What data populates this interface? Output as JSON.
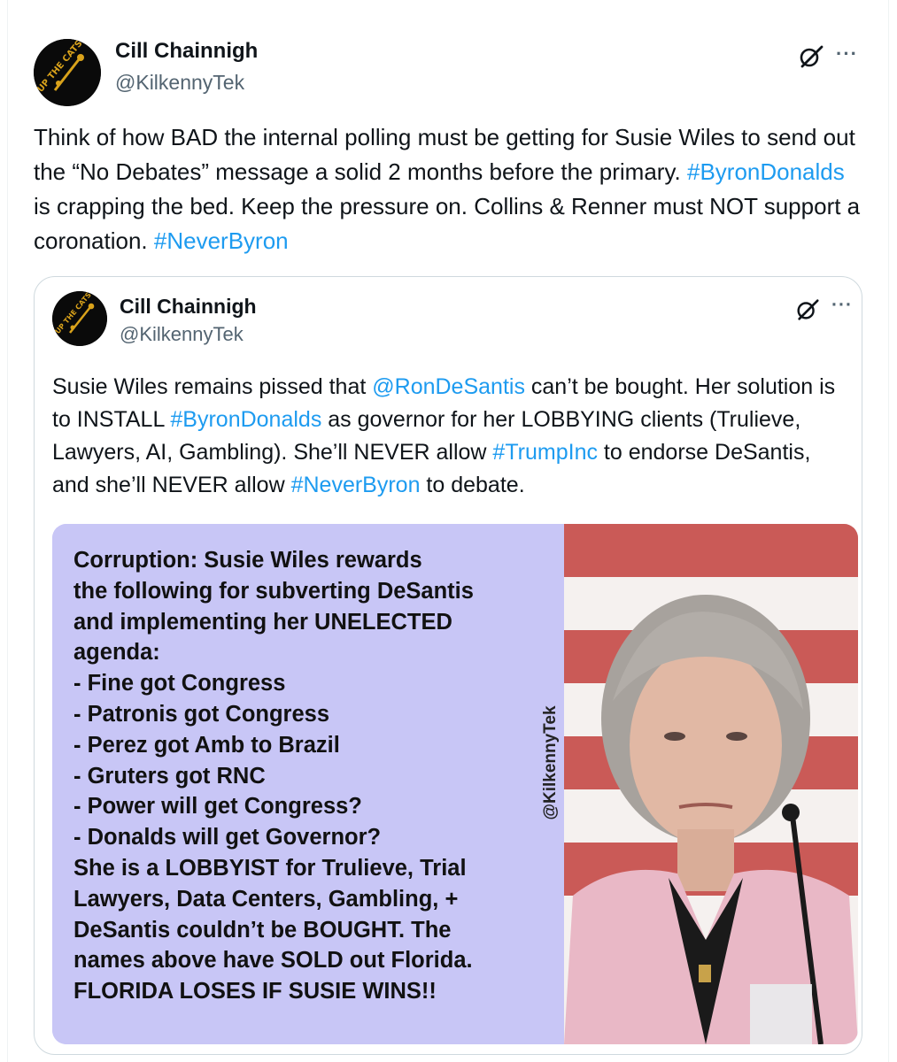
{
  "tweet": {
    "author": {
      "name": "Cill Chainnigh",
      "handle": "@KilkennyTek",
      "avatar_text": "UP THE CATS"
    },
    "text_parts": [
      {
        "text": "Think of how BAD the internal polling must be getting for Susie Wiles to send out the “No Debates” message a solid 2 months before the primary. ",
        "type": "text"
      },
      {
        "text": "#ByronDonalds",
        "type": "hashtag"
      },
      {
        "text": " is crapping the bed. Keep the pressure on. Collins & Renner must NOT support a coronation. ",
        "type": "text"
      },
      {
        "text": "#NeverByron",
        "type": "hashtag"
      }
    ]
  },
  "quoted_tweet": {
    "author": {
      "name": "Cill Chainnigh",
      "handle": "@KilkennyTek",
      "avatar_text": "UP THE CATS"
    },
    "text_parts": [
      {
        "text": "Susie Wiles remains pissed that ",
        "type": "text"
      },
      {
        "text": "@RonDeSantis",
        "type": "mention"
      },
      {
        "text": " can’t be bought. Her solution is to INSTALL ",
        "type": "text"
      },
      {
        "text": "#ByronDonalds",
        "type": "hashtag"
      },
      {
        "text": " as governor for her LOBBYING clients (Trulieve, Lawyers, AI, Gambling). She’ll NEVER allow ",
        "type": "text"
      },
      {
        "text": "#TrumpInc",
        "type": "hashtag"
      },
      {
        "text": " to endorse DeSantis, and she’ll NEVER allow ",
        "type": "text"
      },
      {
        "text": "#NeverByron",
        "type": "hashtag"
      },
      {
        "text": " to debate.",
        "type": "text"
      }
    ],
    "image": {
      "text_lines": [
        "Corruption: Susie Wiles rewards",
        "the following for subverting DeSantis",
        "and implementing her UNELECTED",
        "agenda:",
        "- Fine got Congress",
        "- Patronis got Congress",
        "- Perez got Amb to Brazil",
        "- Gruters got RNC",
        "- Power will get Congress?",
        "- Donalds will get Governor?",
        "She is a LOBBYIST for Trulieve, Trial",
        "Lawyers, Data Centers, Gambling, +",
        "DeSantis couldn’t be BOUGHT. The",
        "names above have SOLD out Florida.",
        "FLORIDA LOSES IF SUSIE WINS!!"
      ],
      "watermark": "@KilkennyTek",
      "panel_color": "#c8c6f6"
    }
  },
  "icons": {
    "grok": "grok-icon",
    "more": "more-icon"
  },
  "colors": {
    "link": "#1d9bf0",
    "text": "#0f1419",
    "secondary": "#536471",
    "border": "#cfd9de"
  }
}
